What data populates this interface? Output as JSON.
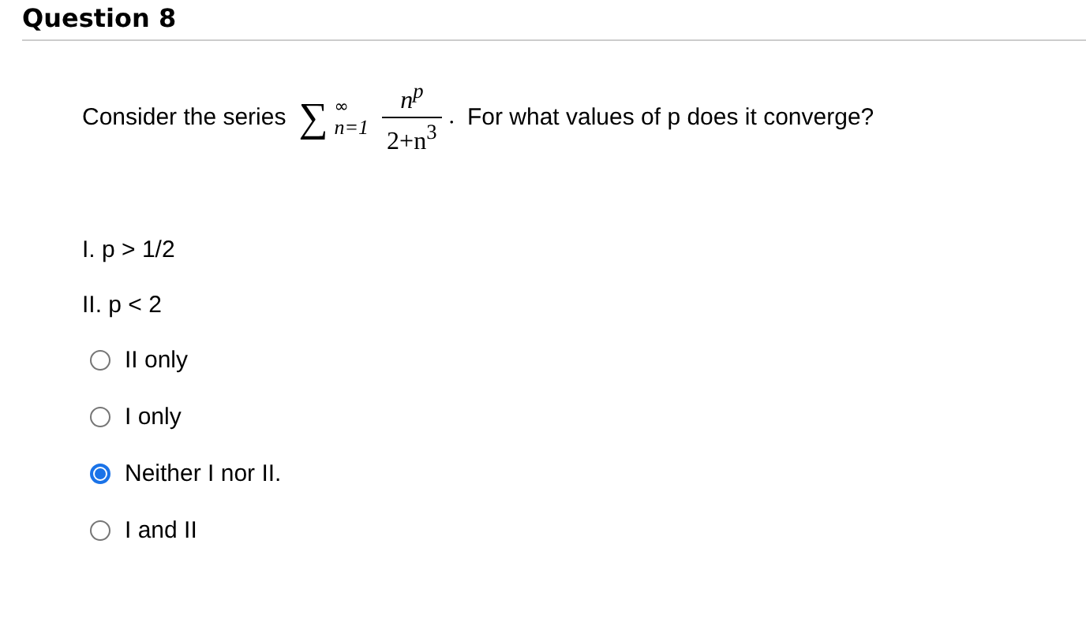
{
  "title": "Question 8",
  "prompt": {
    "before": "Consider the series",
    "sigma": "∑",
    "upper": "∞",
    "lower": "n=1",
    "numerator": "n$^{p}$",
    "denominator": "2+n$^{3}$",
    "period": ".",
    "after": "For what values of p does it converge?"
  },
  "statements": [
    "I. p > 1/2",
    "II. p < 2"
  ],
  "options": [
    {
      "label": "II only",
      "selected": false
    },
    {
      "label": "I only",
      "selected": false
    },
    {
      "label": "Neither I nor II.",
      "selected": true
    },
    {
      "label": "I and II",
      "selected": false
    }
  ]
}
